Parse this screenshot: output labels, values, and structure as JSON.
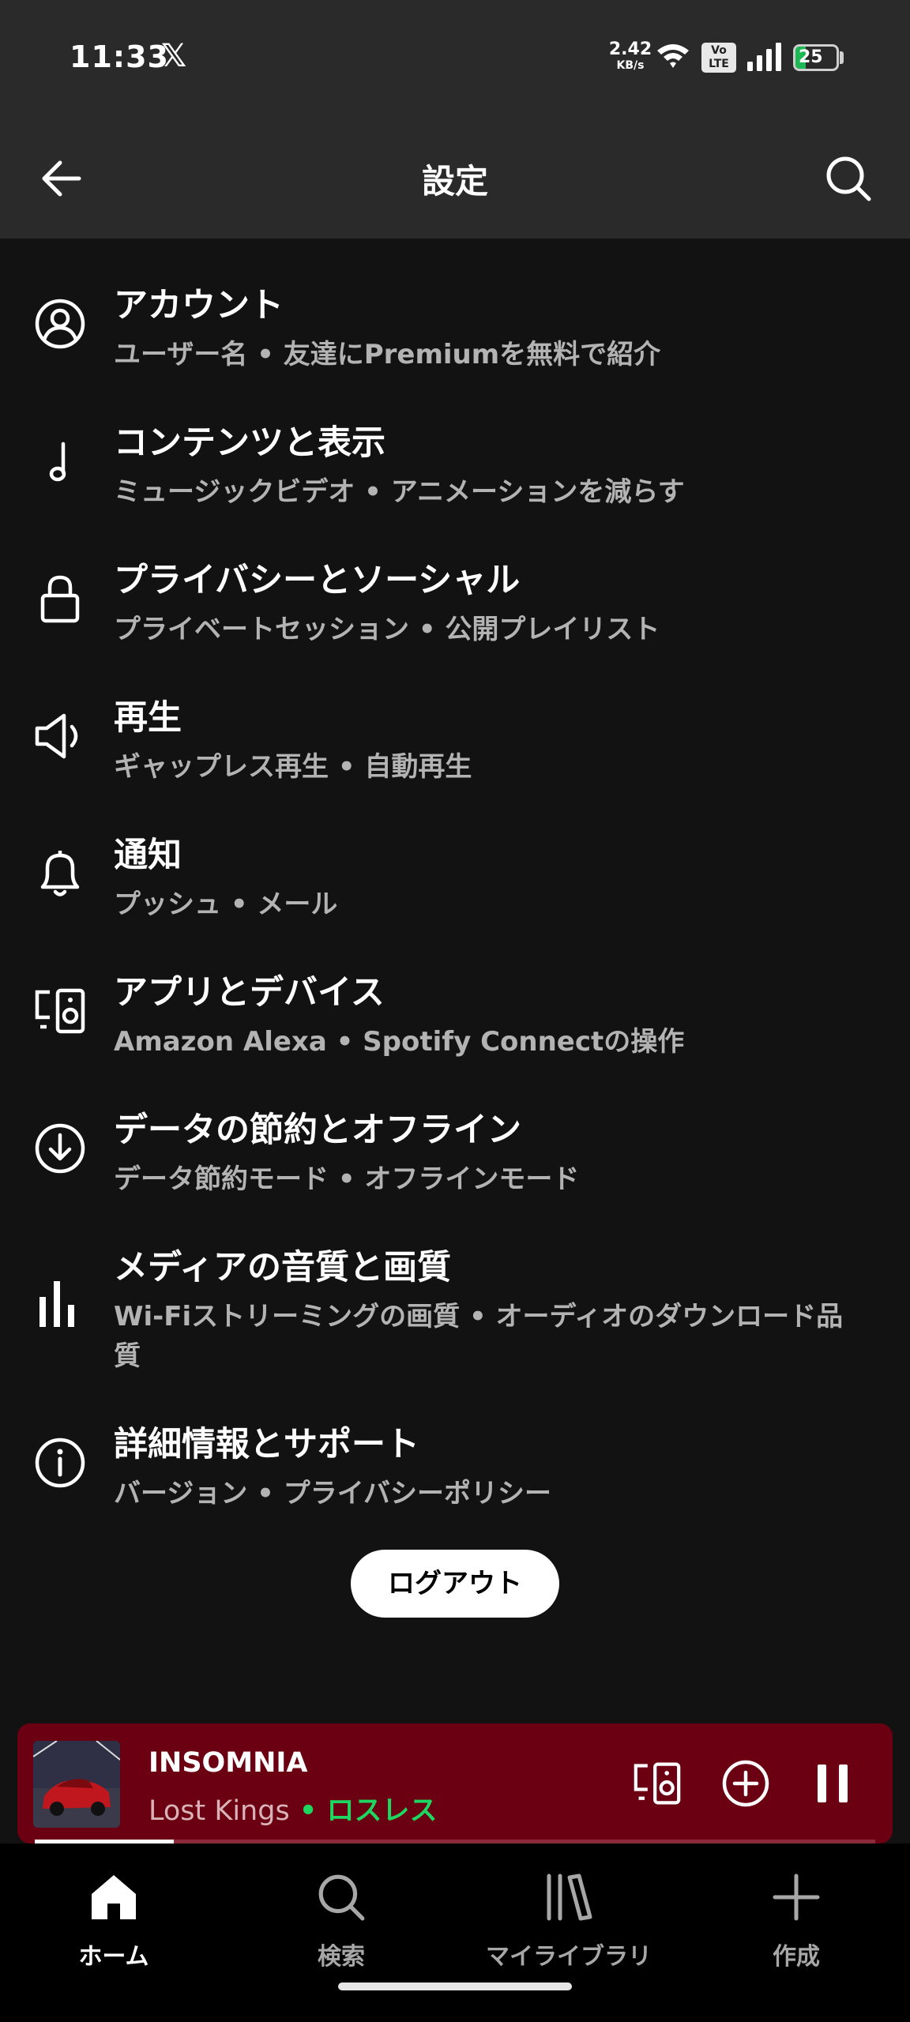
{
  "status": {
    "time": "11:33",
    "x_logo": "𝕏",
    "speed_value": "2.42",
    "speed_unit": "KB/s",
    "volte_line1": "Vo",
    "volte_line2": "LTE",
    "battery": "25",
    "battery_level": 0.25
  },
  "header": {
    "title": "設定",
    "back_icon": "arrow-left-icon",
    "search_icon": "search-icon"
  },
  "settings": [
    {
      "icon": "account-icon",
      "title": "アカウント",
      "subtitle": "ユーザー名 • 友達にPremiumを無料で紹介"
    },
    {
      "icon": "music-note-icon",
      "title": "コンテンツと表示",
      "subtitle": "ミュージックビデオ • アニメーションを減らす"
    },
    {
      "icon": "lock-icon",
      "title": "プライバシーとソーシャル",
      "subtitle": "プライベートセッション • 公開プレイリスト"
    },
    {
      "icon": "speaker-icon",
      "title": "再生",
      "subtitle": "ギャップレス再生 • 自動再生"
    },
    {
      "icon": "bell-icon",
      "title": "通知",
      "subtitle": "プッシュ • メール"
    },
    {
      "icon": "devices-icon",
      "title": "アプリとデバイス",
      "subtitle": "Amazon Alexa • Spotify Connectの操作"
    },
    {
      "icon": "download-icon",
      "title": "データの節約とオフライン",
      "subtitle": "データ節約モード • オフラインモード"
    },
    {
      "icon": "bars-icon",
      "title": "メディアの音質と画質",
      "subtitle": "Wi-Fiストリーミングの画質 • オーディオのダウンロード品質"
    },
    {
      "icon": "info-icon",
      "title": "詳細情報とサポート",
      "subtitle": "バージョン • プライバシーポリシー"
    }
  ],
  "logout_label": "ログアウト",
  "player": {
    "track": "INSOMNIA",
    "artist": "Lost Kings",
    "separator": " • ",
    "badge": "ロスレス",
    "progress": 0.165,
    "bg_color": "#6a0011"
  },
  "nav": [
    {
      "icon": "home-icon",
      "label": "ホーム",
      "active": true
    },
    {
      "icon": "search-icon",
      "label": "検索",
      "active": false
    },
    {
      "icon": "library-icon",
      "label": "マイライブラリ",
      "active": false
    },
    {
      "icon": "plus-icon",
      "label": "作成",
      "active": false
    }
  ],
  "colors": {
    "accent_green": "#1ed760",
    "background": "#121212",
    "header": "#2a2a2a"
  }
}
